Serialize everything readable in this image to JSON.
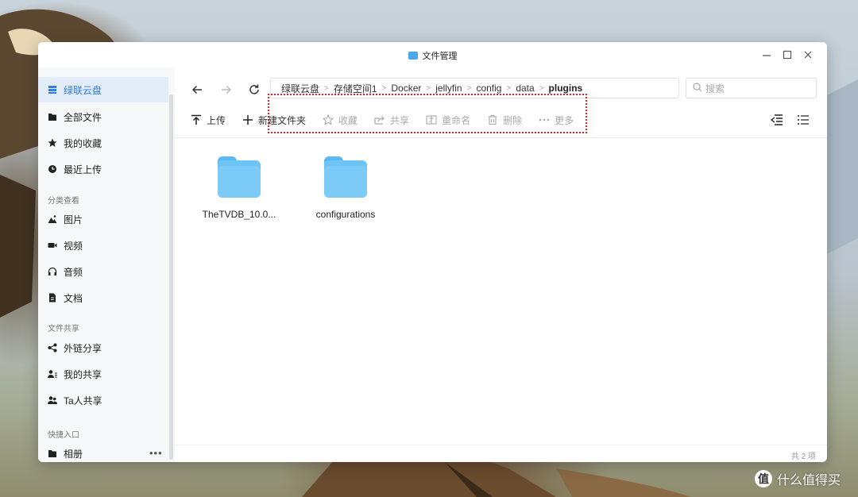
{
  "window": {
    "title": "文件管理",
    "icon": "folder-app-icon"
  },
  "sidebar": {
    "items": [
      {
        "label": "绿联云盘",
        "icon": "cloud-disk-icon"
      },
      {
        "label": "全部文件",
        "icon": "folder-icon"
      },
      {
        "label": "我的收藏",
        "icon": "star-icon"
      },
      {
        "label": "最近上传",
        "icon": "clock-icon"
      }
    ],
    "section_category": "分类查看",
    "category_items": [
      {
        "label": "图片",
        "icon": "image-icon"
      },
      {
        "label": "视频",
        "icon": "video-icon"
      },
      {
        "label": "音频",
        "icon": "headphones-icon"
      },
      {
        "label": "文档",
        "icon": "document-icon"
      }
    ],
    "section_share": "文件共享",
    "share_items": [
      {
        "label": "外链分享",
        "icon": "share-icon"
      },
      {
        "label": "我的共享",
        "icon": "user-share-icon"
      },
      {
        "label": "Ta人共享",
        "icon": "users-icon"
      }
    ],
    "section_quick": "快捷入口",
    "quick_more": "•••",
    "quick_items": [
      {
        "label": "相册",
        "icon": "folder-icon"
      }
    ]
  },
  "breadcrumb": [
    "绿联云盘",
    "存储空间1",
    "Docker",
    "jellyfin",
    "config",
    "data",
    "plugins"
  ],
  "search": {
    "placeholder": "搜索"
  },
  "toolbar": {
    "upload": "上传",
    "new_folder": "新建文件夹",
    "favorite": "收藏",
    "share": "共享",
    "rename": "重命名",
    "delete": "删除",
    "more": "更多"
  },
  "files": [
    {
      "name": "TheTVDB_10.0...",
      "type": "folder"
    },
    {
      "name": "configurations",
      "type": "folder"
    }
  ],
  "status": {
    "count": "共 2 项"
  },
  "watermark": {
    "logo": "值",
    "text": "什么值得买"
  },
  "colors": {
    "accent": "#2f7de1",
    "folder": "#6ec4f6",
    "highlight": "#e0262a"
  }
}
